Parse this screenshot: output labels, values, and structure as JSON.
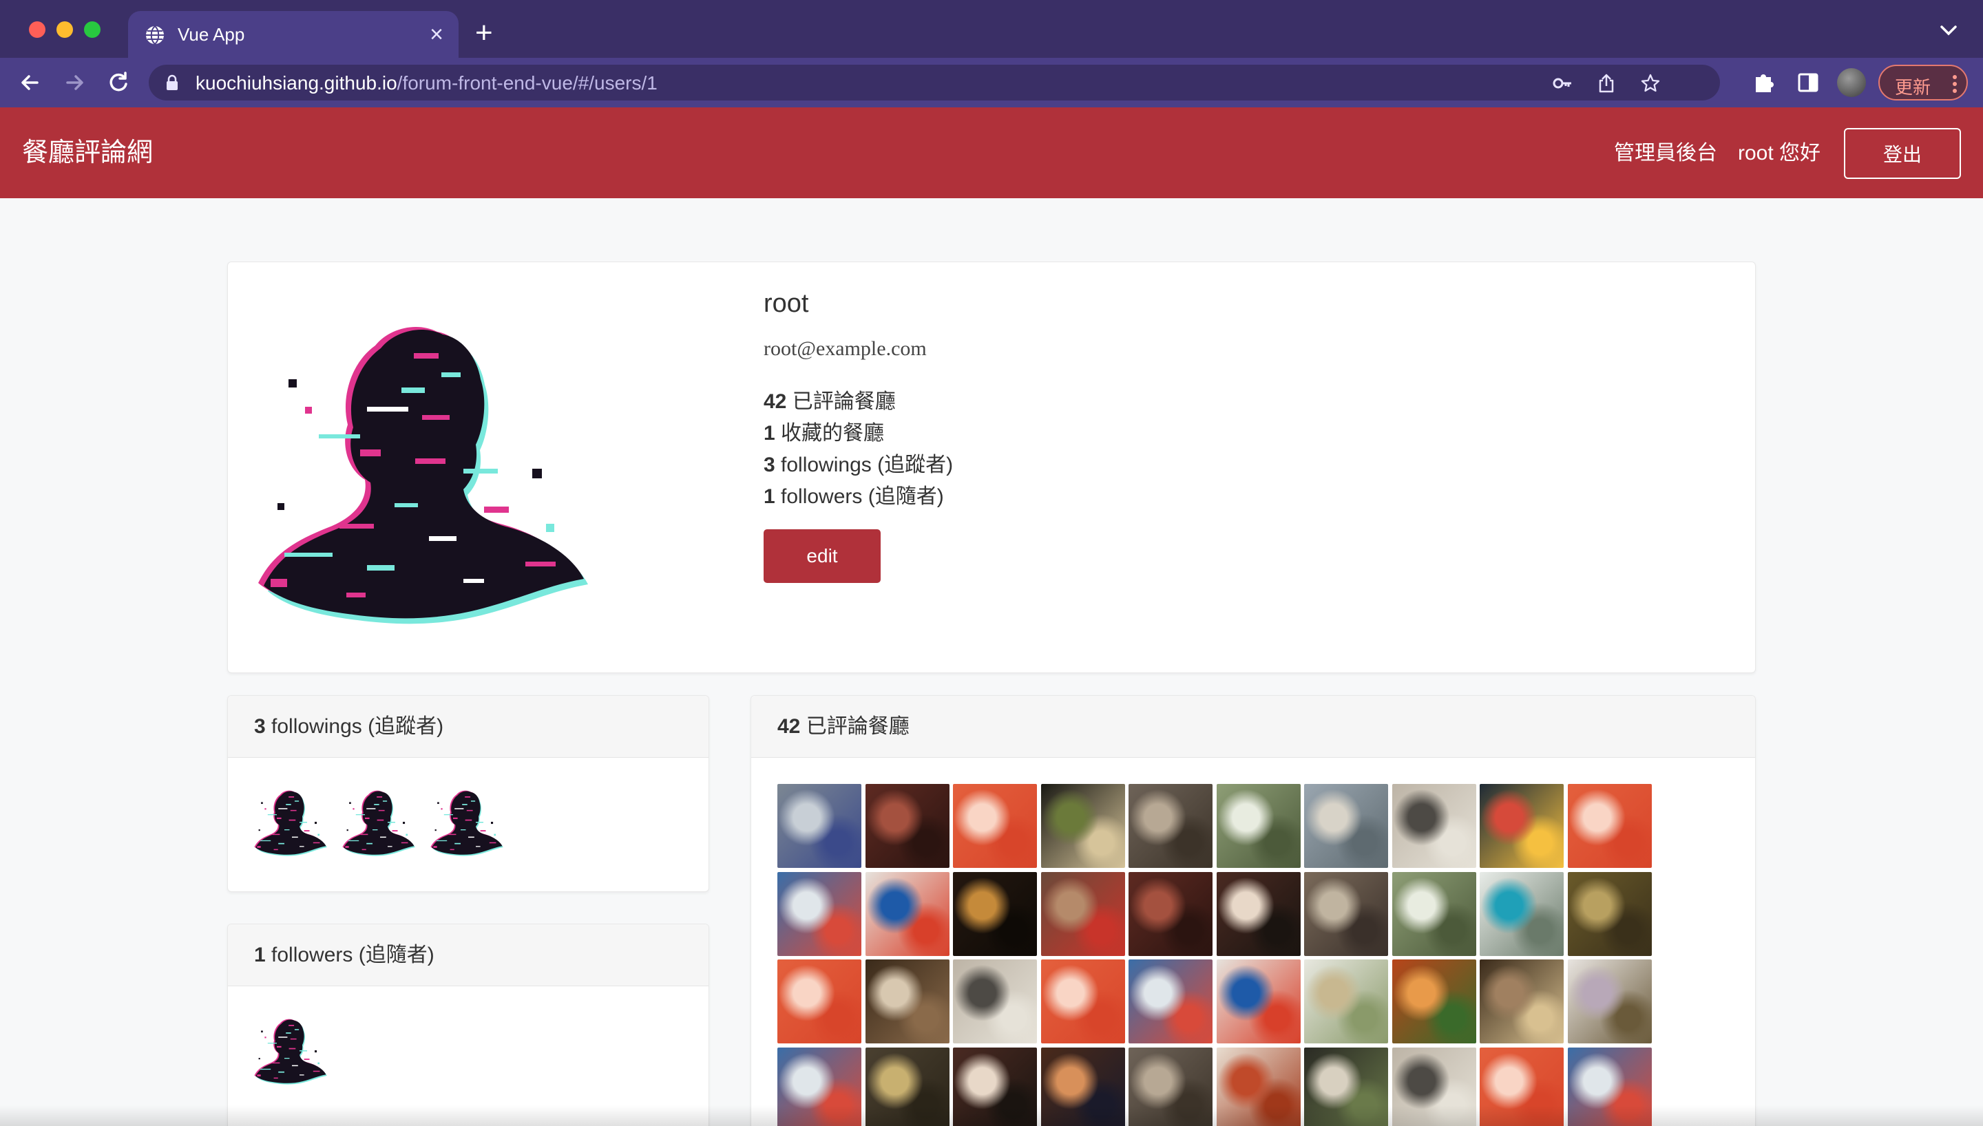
{
  "browser": {
    "tab_title": "Vue App",
    "url_host": "kuochiuhsiang.github.io",
    "url_path": "/forum-front-end-vue/#/users/1",
    "update_label": "更新",
    "accent": "#4b3f88"
  },
  "navbar": {
    "brand": "餐廳評論網",
    "admin_link": "管理員後台",
    "greeting": "root 您好",
    "logout_label": "登出",
    "color": "#b0313a"
  },
  "profile": {
    "name": "root",
    "email": "root@example.com",
    "stats": [
      {
        "count": "42",
        "label": " 已評論餐廳"
      },
      {
        "count": "1",
        "label": " 收藏的餐廳"
      },
      {
        "count": "3",
        "label": " followings (追蹤者)"
      },
      {
        "count": "1",
        "label": " followers (追隨者)"
      }
    ],
    "edit_label": "edit"
  },
  "followings": {
    "count": "3",
    "title": " followings (追蹤者)",
    "avatars": 3
  },
  "followers": {
    "count": "1",
    "title": " followers (追隨者)",
    "avatars": 1
  },
  "comments": {
    "count": "42",
    "title": " 已評論餐廳",
    "thumbnail_palettes": [
      [
        "#7c8793",
        "#c8cfd6",
        "#3b4a8a"
      ],
      [
        "#5e2a22",
        "#a4513f",
        "#2b1410"
      ],
      [
        "#e4603d",
        "#f9d5c5",
        "#d8452a"
      ],
      [
        "#1a1a14",
        "#6b7a3a",
        "#d6c49a"
      ],
      [
        "#6e6358",
        "#b7a894",
        "#3c3329"
      ],
      [
        "#8e9e76",
        "#e8ece0",
        "#4c5a3a"
      ],
      [
        "#9aa6b0",
        "#d8d3c8",
        "#5e6a70"
      ],
      [
        "#bdb4a6",
        "#4d4a45",
        "#e6e2d8"
      ],
      [
        "#1e2a36",
        "#d64a3a",
        "#f5c040"
      ],
      [
        "#e4603d",
        "#f9d5c5",
        "#d8452a"
      ],
      [
        "#3a6ea8",
        "#e0e6ea",
        "#d84a3a"
      ],
      [
        "#e6e2dc",
        "#1e5aa8",
        "#d8402a"
      ],
      [
        "#241810",
        "#c58a3a",
        "#0e0a06"
      ],
      [
        "#6b4a3a",
        "#b58a6a",
        "#c8342a"
      ],
      [
        "#5e2a22",
        "#a4513f",
        "#2b1410"
      ],
      [
        "#4a2a22",
        "#e8d8c8",
        "#1a1410"
      ],
      [
        "#7a6a5a",
        "#c0b4a0",
        "#3a302a"
      ],
      [
        "#8e9e76",
        "#e8ece0",
        "#4c5a3a"
      ],
      [
        "#e8ece8",
        "#1fa0b8",
        "#6a7a6a"
      ],
      [
        "#6a5a2a",
        "#b8a060",
        "#3a301a"
      ],
      [
        "#e4603d",
        "#f9d5c5",
        "#d8452a"
      ],
      [
        "#3a2a1a",
        "#d8c8b0",
        "#8a6a4a"
      ],
      [
        "#bdb4a6",
        "#4d4a45",
        "#e6e2d8"
      ],
      [
        "#e4603d",
        "#f9d5c5",
        "#d8452a"
      ],
      [
        "#3a6ea8",
        "#e0e6ea",
        "#d84a3a"
      ],
      [
        "#e6e2dc",
        "#1e5aa8",
        "#d8402a"
      ],
      [
        "#e8e8e0",
        "#c8b890",
        "#8a9a6a"
      ],
      [
        "#b8451a",
        "#e89a4a",
        "#3a6a2a"
      ],
      [
        "#3a2a1a",
        "#a08060",
        "#d8c090"
      ],
      [
        "#e8e4e0",
        "#b8a8b8",
        "#6a5a3a"
      ],
      [
        "#3a6ea8",
        "#e0e6ea",
        "#d84a3a"
      ],
      [
        "#4a4030",
        "#c8b070",
        "#2a2418"
      ],
      [
        "#4a2a22",
        "#e8d8c8",
        "#1a1410"
      ],
      [
        "#4a2a1a",
        "#d8905a",
        "#1a1a2a"
      ],
      [
        "#6e6358",
        "#b7a894",
        "#3c3329"
      ],
      [
        "#e8ddd0",
        "#c04a2a",
        "#a0381a"
      ],
      [
        "#2a2a24",
        "#d8d0c0",
        "#6a7a4a"
      ],
      [
        "#bdb4a6",
        "#4d4a45",
        "#e6e2d8"
      ],
      [
        "#e4603d",
        "#f9d5c5",
        "#d8452a"
      ],
      [
        "#3a6ea8",
        "#e0e6ea",
        "#d84a3a"
      ]
    ]
  }
}
